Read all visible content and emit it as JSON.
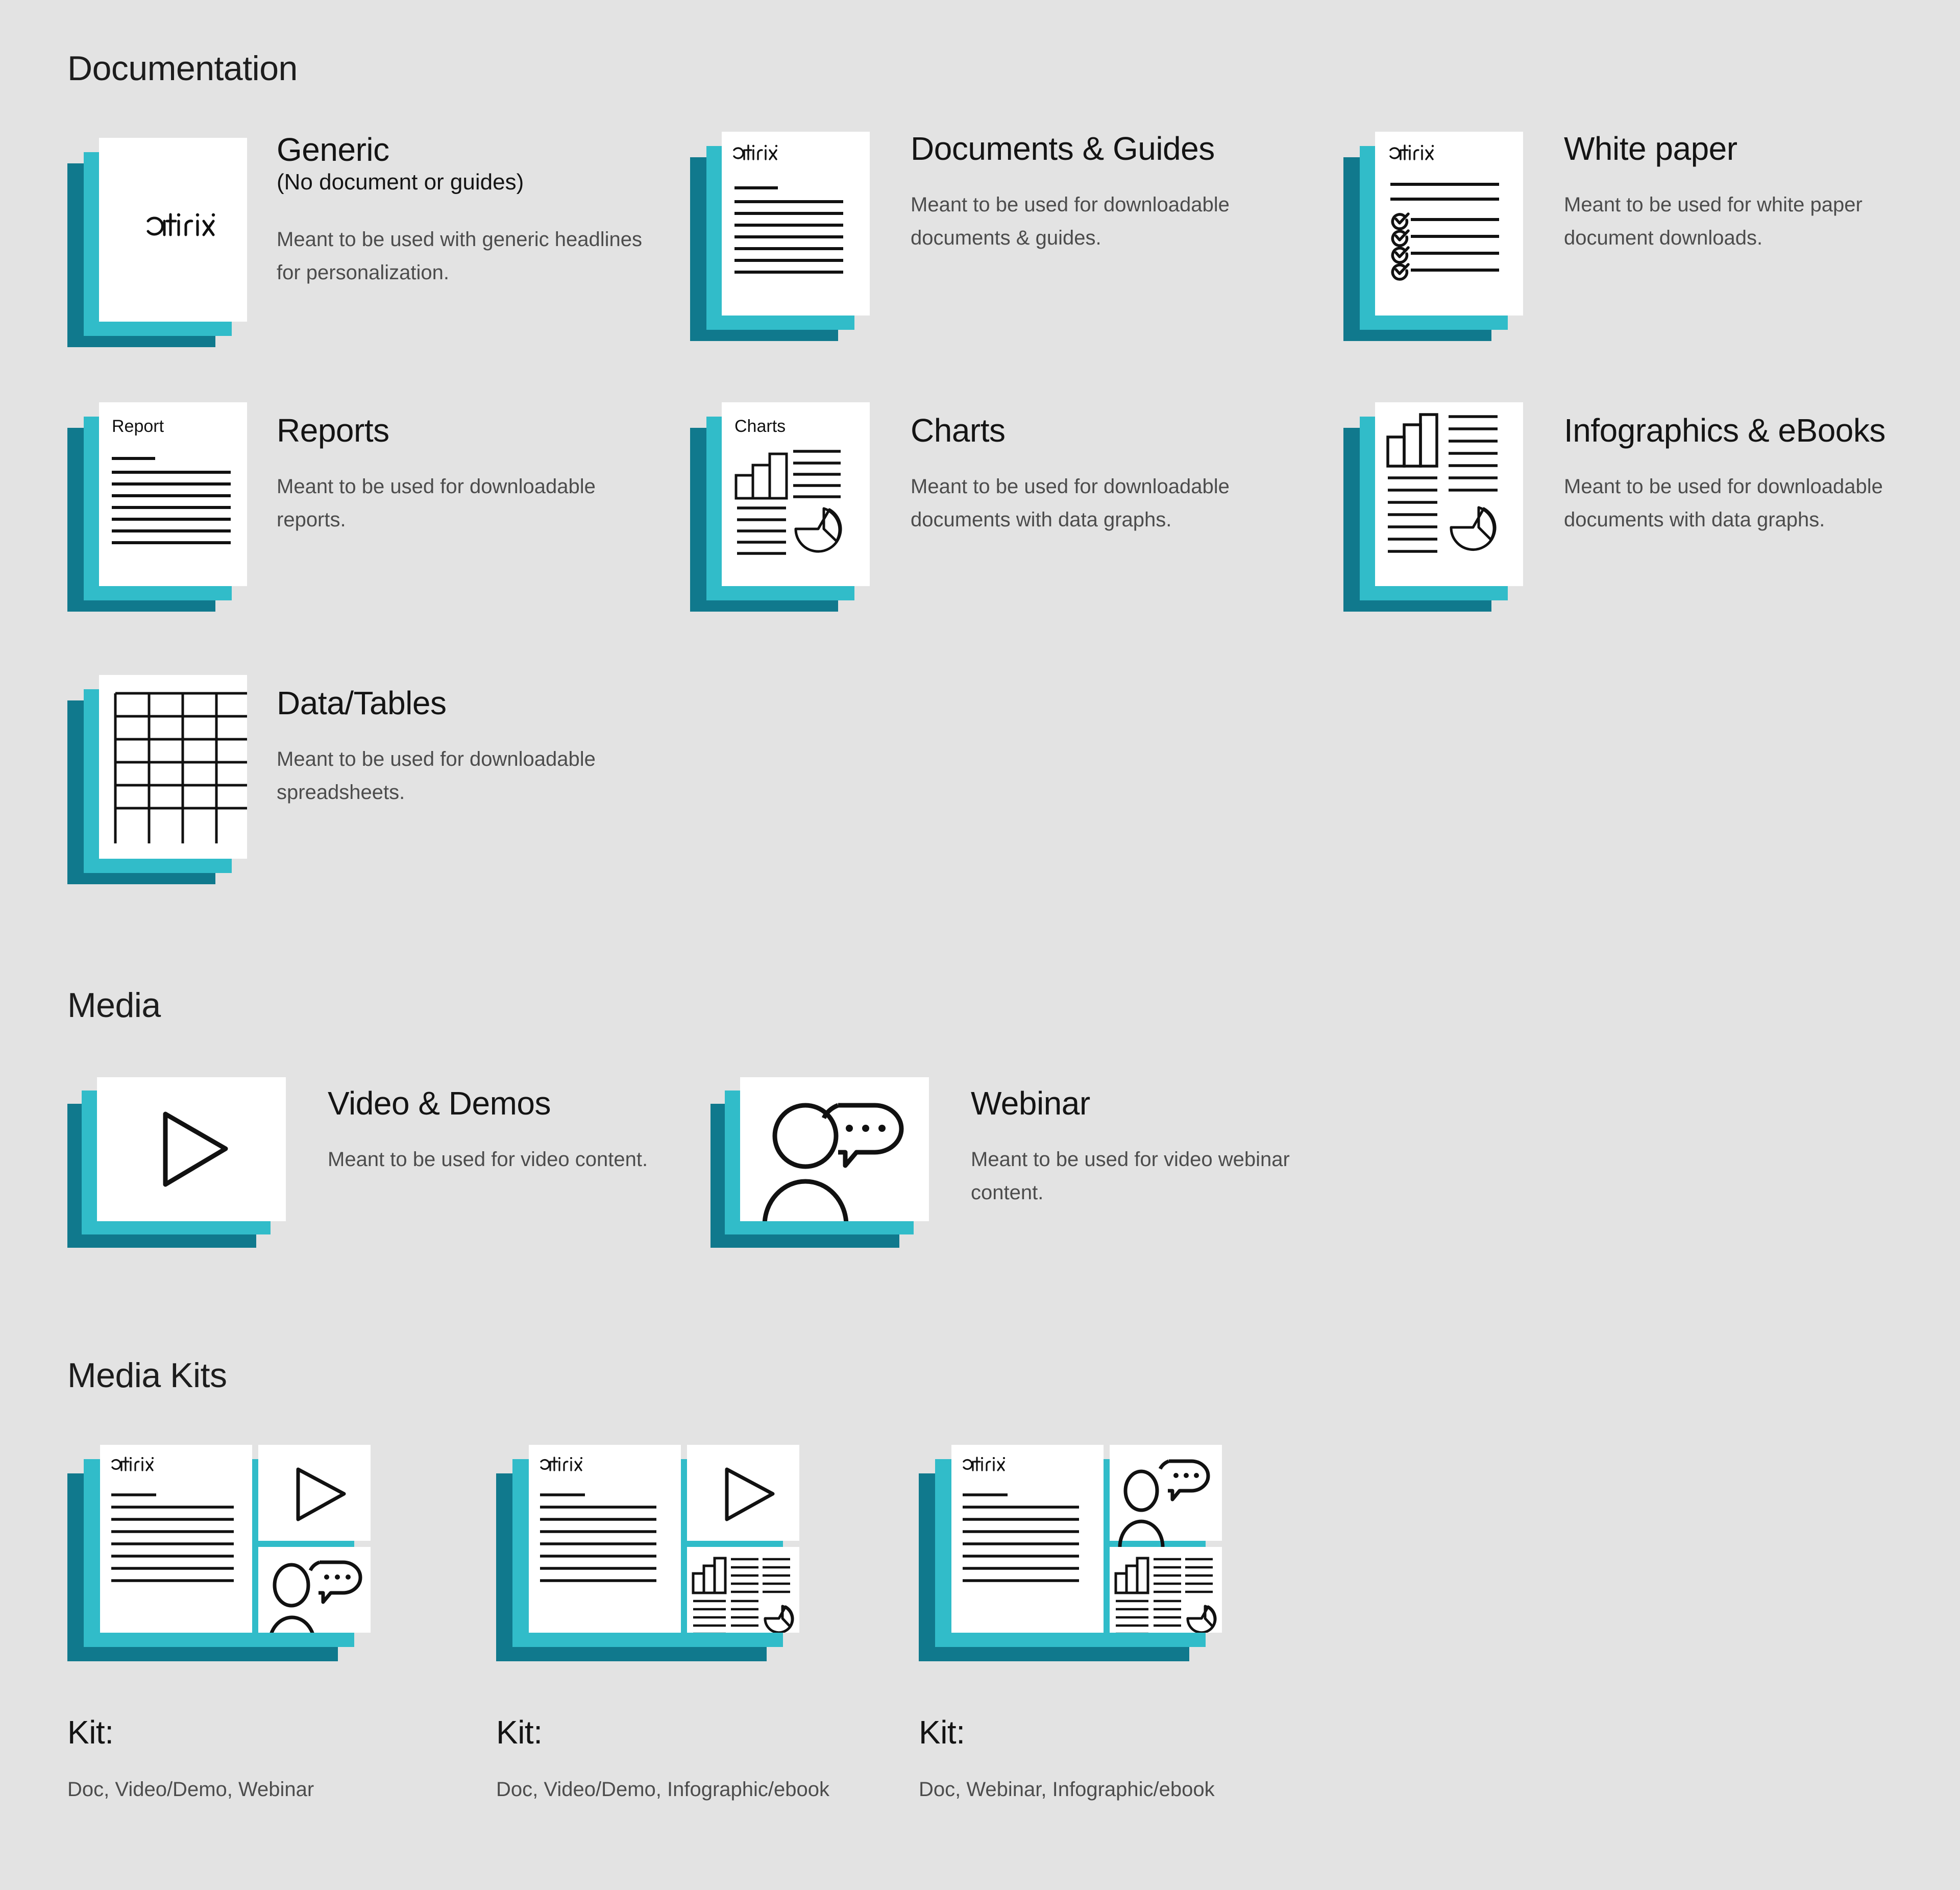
{
  "sections": [
    {
      "id": "documentation",
      "title": "Documentation",
      "items": [
        {
          "id": "generic",
          "icon": "document-citrix-logo-icon",
          "title": "Generic",
          "subtitle": "(No document or guides)",
          "desc": "Meant to be used with generic headlines for personalization.",
          "sheet_label": "citrix"
        },
        {
          "id": "documents-guides",
          "icon": "document-lines-icon",
          "title": "Documents & Guides",
          "subtitle": "",
          "desc": "Meant to be used for  downloadable documents & guides.",
          "sheet_label": "citrix"
        },
        {
          "id": "white-paper",
          "icon": "document-checklist-icon",
          "title": "White paper",
          "subtitle": "",
          "desc": "Meant to be used for white paper document downloads.",
          "sheet_label": "citrix"
        },
        {
          "id": "reports",
          "icon": "document-report-icon",
          "title": "Reports",
          "subtitle": "",
          "desc": "Meant to be used for downloadable reports.",
          "sheet_label": "Report"
        },
        {
          "id": "charts",
          "icon": "document-charts-icon",
          "title": "Charts",
          "subtitle": "",
          "desc": "Meant to be used for downloadable documents with data graphs.",
          "sheet_label": "Charts"
        },
        {
          "id": "infographics-ebooks",
          "icon": "document-infographic-icon",
          "title": "Infographics & eBooks",
          "subtitle": "",
          "desc": "Meant to be used for downloadable documents with data graphs.",
          "sheet_label": ""
        },
        {
          "id": "data-tables",
          "icon": "document-table-icon",
          "title": "Data/Tables",
          "subtitle": "",
          "desc": "Meant to be used for downloadable spreadsheets.",
          "sheet_label": ""
        }
      ]
    },
    {
      "id": "media",
      "title": "Media",
      "items": [
        {
          "id": "video-demos",
          "icon": "video-play-icon",
          "title": "Video & Demos",
          "subtitle": "",
          "desc": "Meant to be used for video content.",
          "sheet_label": ""
        },
        {
          "id": "webinar",
          "icon": "webinar-person-speech-icon",
          "title": "Webinar",
          "subtitle": "",
          "desc": "Meant to be used for video webinar content.",
          "sheet_label": ""
        }
      ]
    },
    {
      "id": "media-kits",
      "title": "Media Kits",
      "items": [
        {
          "id": "kit-1",
          "icon": "kit-doc-video-webinar-icon",
          "title": "Kit:",
          "subtitle": "",
          "desc": "Doc, Video/Demo, Webinar",
          "sheet_label": "citrix"
        },
        {
          "id": "kit-2",
          "icon": "kit-doc-video-infographic-icon",
          "title": "Kit:",
          "subtitle": "",
          "desc": "Doc, Video/Demo, Infographic/ebook",
          "sheet_label": "citrix"
        },
        {
          "id": "kit-3",
          "icon": "kit-doc-webinar-infographic-icon",
          "title": "Kit:",
          "subtitle": "",
          "desc": "Doc, Webinar, Infographic/ebook",
          "sheet_label": "citrix"
        }
      ]
    }
  ],
  "colors": {
    "background": "#e3e3e3",
    "teal_dark": "#10798d",
    "teal_bright": "#31bcc9",
    "sheet_white": "#ffffff",
    "ink": "#141414",
    "body_text": "#4c4c4c"
  }
}
